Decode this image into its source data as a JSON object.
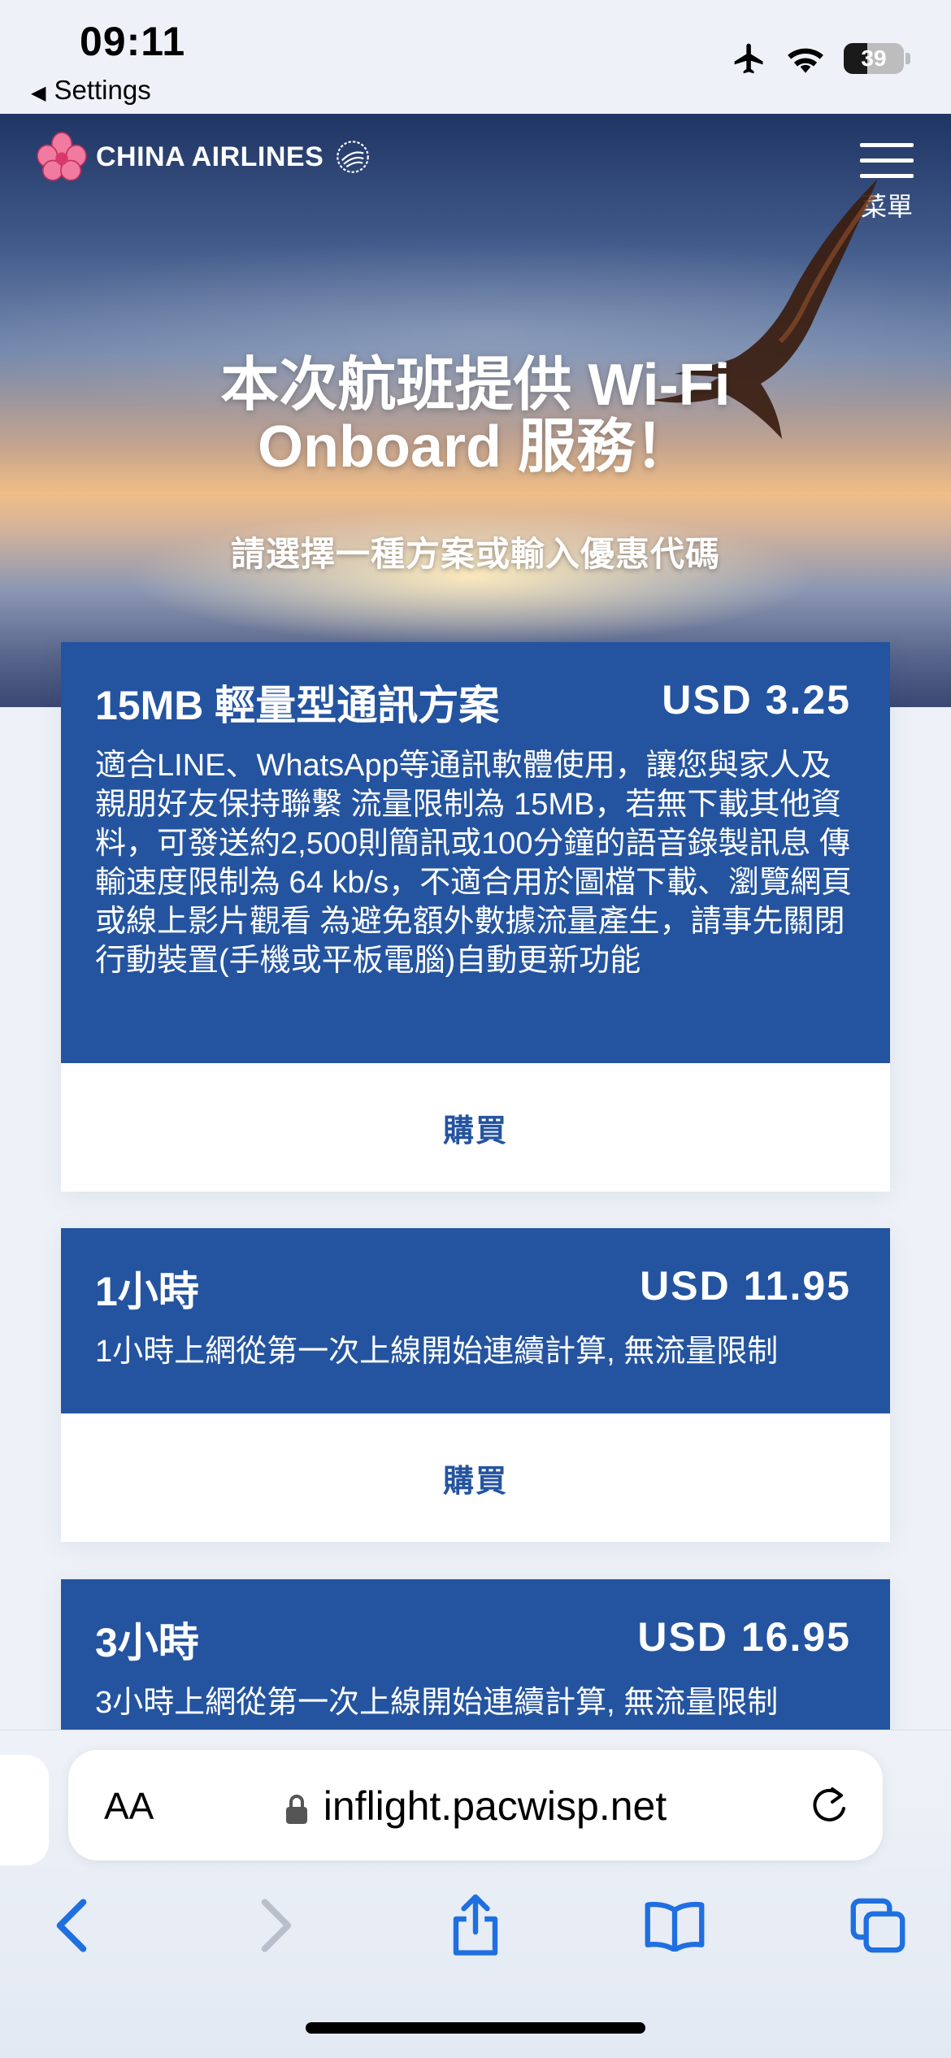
{
  "status_bar": {
    "time": "09:11",
    "back_label": "Settings",
    "battery_level": "39",
    "battery_fraction": 0.39,
    "icons": [
      "airplane-icon",
      "wifi-icon",
      "battery-icon"
    ]
  },
  "header": {
    "brand_name": "CHINA AIRLINES",
    "menu_label": "菜單"
  },
  "hero": {
    "title_line1": "本次航班提供 Wi-Fi",
    "title_line2": "Onboard 服務！",
    "subtitle": "請選擇一種方案或輸入優惠代碼"
  },
  "plans": [
    {
      "name": "15MB 輕量型通訊方案",
      "price": "USD 3.25",
      "description": "適合LINE、WhatsApp等通訊軟體使用，讓您與家人及親朋好友保持聯繫 流量限制為 15MB，若無下載其他資料，可發送約2,500則簡訊或100分鐘的語音錄製訊息 傳輸速度限制為 64 kb/s，不適合用於圖檔下載、瀏覽網頁或線上影片觀看 為避免額外數據流量產生，請事先關閉行動裝置(手機或平板電腦)自動更新功能",
      "buy_label": "購買"
    },
    {
      "name": "1小時",
      "price": "USD 11.95",
      "description": "1小時上網從第一次上線開始連續計算, 無流量限制",
      "buy_label": "購買"
    },
    {
      "name": "3小時",
      "price": "USD 16.95",
      "description": "3小時上網從第一次上線開始連續計算, 無流量限制"
    }
  ],
  "browser": {
    "text_size_label": "AA",
    "url": "inflight.pacwisp.net",
    "toolbar_icons": [
      "back-icon",
      "forward-icon",
      "share-icon",
      "bookmarks-icon",
      "tabs-icon"
    ]
  },
  "colors": {
    "plan_blue": "#2454a0",
    "page_bg": "#eef2f8"
  }
}
